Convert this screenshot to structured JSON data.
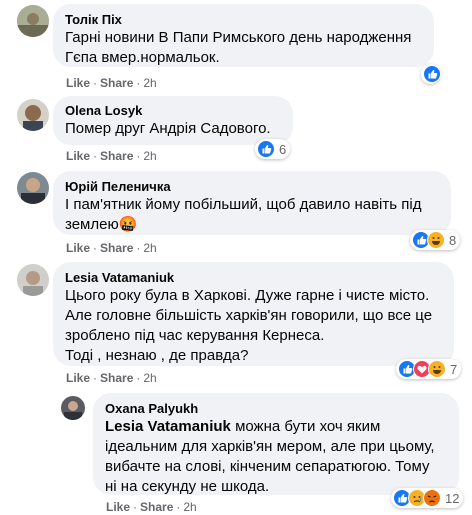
{
  "action_labels": {
    "like": "Like",
    "share": "Share"
  },
  "comments": [
    {
      "author": "Толік Піх",
      "text": "Гарні новини В Папи Римського день народження\nГєпа вмер.нормальок.",
      "time": "2h",
      "reaction_count": "",
      "reactions": [
        "like-icon"
      ]
    },
    {
      "author": "Olena Losyk",
      "text": "Помер друг Андрія Садового.",
      "time": "2h",
      "reaction_count": "6",
      "reactions": [
        "like-icon"
      ]
    },
    {
      "author": "Юрій Пеленичка",
      "text": "І пам'ятник йому побільший, щоб давило навіть під\nземлею🤬",
      "time": "2h",
      "reaction_count": "8",
      "reactions": [
        "like-icon",
        "haha-icon"
      ]
    },
    {
      "author": "Lesia Vatamaniuk",
      "text": "Цього року була в Харкові. Дуже гарне і чисте місто.\nАле головне більшість харків'ян говорили, що все це\nзроблено під час керування Кернеса.\nТоді , незнаю , де правда?",
      "time": "2h",
      "reaction_count": "7",
      "reactions": [
        "like-icon",
        "love-icon",
        "haha-icon"
      ]
    },
    {
      "author": "Oxana Palyukh",
      "mention": "Lesia Vatamaniuk",
      "text": " можна бути хоч яким\nідеальним для харків'ян мером, але при цьому,\nвибачте на слові, кінченим сепаратюгою. Тому\nні на секунду не шкода.",
      "time": "2h",
      "reaction_count": "12",
      "reactions": [
        "like-icon",
        "sad-icon",
        "angry-icon"
      ]
    }
  ],
  "colors": {
    "like": "#1877f2",
    "love": "#f33e58",
    "haha": "#f7b125",
    "bubble": "#f0f2f5",
    "meta": "#65676b"
  }
}
